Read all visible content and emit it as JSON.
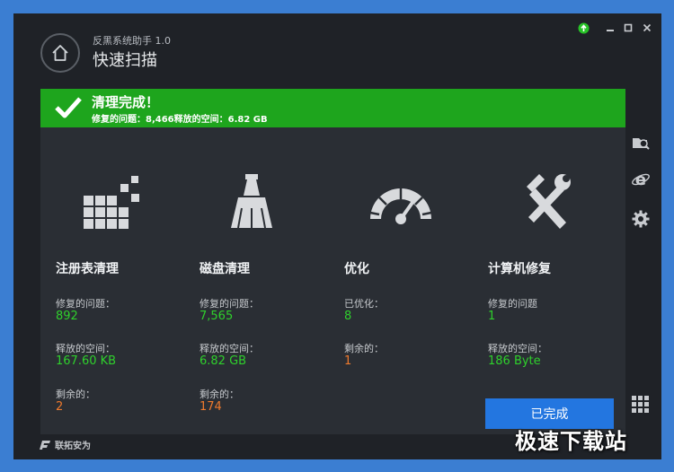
{
  "app": {
    "title": "反黑系统助手 1.0",
    "page_title": "快速扫描"
  },
  "window_controls": {
    "update_icon": "update-arrow-icon",
    "minimize_icon": "minimize-icon",
    "maximize_icon": "maximize-icon",
    "close_icon": "close-icon"
  },
  "banner": {
    "title": "清理完成！",
    "summary": "修复的问题：8,466释放的空间：6.82 GB",
    "color": "#1ea51d"
  },
  "columns": [
    {
      "name": "注册表清理",
      "icon": "registry-blocks-icon",
      "stats": [
        {
          "label": "修复的问题：",
          "value": "892",
          "tone": "green"
        },
        {
          "label": "释放的空间：",
          "value": "167.60 KB",
          "tone": "green"
        },
        {
          "label": "剩余的：",
          "value": "2",
          "tone": "orange"
        }
      ]
    },
    {
      "name": "磁盘清理",
      "icon": "broom-icon",
      "stats": [
        {
          "label": "修复的问题：",
          "value": "7,565",
          "tone": "green"
        },
        {
          "label": "释放的空间：",
          "value": "6.82 GB",
          "tone": "green"
        },
        {
          "label": "剩余的：",
          "value": "174",
          "tone": "orange"
        }
      ]
    },
    {
      "name": "优化",
      "icon": "speedometer-icon",
      "stats": [
        {
          "label": "已优化：",
          "value": "8",
          "tone": "green"
        },
        {
          "label": "剩余的：",
          "value": "1",
          "tone": "orange"
        }
      ]
    },
    {
      "name": "计算机修复",
      "icon": "wrench-hammer-icon",
      "stats": [
        {
          "label": "修复的问题",
          "value": "1",
          "tone": "green"
        },
        {
          "label": "释放的空间：",
          "value": "186 Byte",
          "tone": "green"
        }
      ]
    }
  ],
  "done_button": {
    "label": "已完成"
  },
  "sidebar": [
    {
      "icon": "disk-search-icon"
    },
    {
      "icon": "browser-e-icon"
    },
    {
      "icon": "gear-icon"
    },
    {
      "icon": "grid-apps-icon"
    }
  ],
  "footer": {
    "brand": "联拓安为",
    "watermark": "极速下载站"
  },
  "colors": {
    "accent_green": "#2fd02c",
    "warning_orange": "#ef7a2d",
    "button_blue": "#2376e0"
  }
}
